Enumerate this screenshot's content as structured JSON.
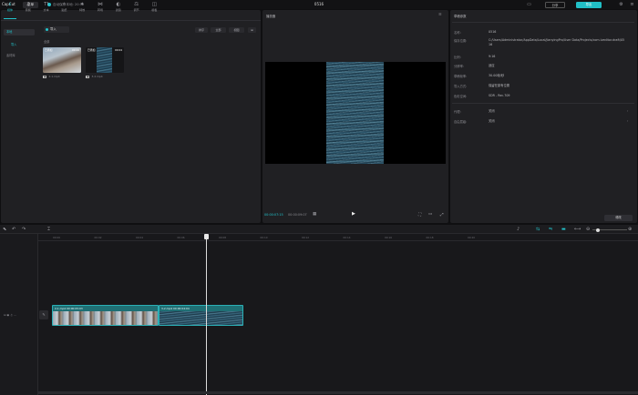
{
  "titlebar": {
    "logo": "CapCut",
    "menu_label": "菜单",
    "autosave": "自动保存本地: 20:52",
    "doc_title": "0516",
    "share_label": "分享",
    "export_label": "导出"
  },
  "tools": [
    {
      "icon": "⭳",
      "label": "媒体",
      "name": "media"
    },
    {
      "icon": "♫",
      "label": "音频",
      "name": "audio"
    },
    {
      "icon": "TI",
      "label": "文本",
      "name": "text"
    },
    {
      "icon": "✧",
      "label": "贴纸",
      "name": "sticker"
    },
    {
      "icon": "✦",
      "label": "特效",
      "name": "effects"
    },
    {
      "icon": "⋈",
      "label": "转场",
      "name": "transition"
    },
    {
      "icon": "◐",
      "label": "滤镜",
      "name": "filter"
    },
    {
      "icon": "⚖",
      "label": "调节",
      "name": "adjust"
    },
    {
      "icon": "◫",
      "label": "模板",
      "name": "template"
    }
  ],
  "sidebar": [
    "本地",
    "导入",
    "素材库"
  ],
  "media": {
    "import_label": "导入",
    "all_label": "全部",
    "sort_label": "排序",
    "filter_label": "全部",
    "view_label": "视图",
    "items": [
      {
        "tag": "已添加",
        "duration": "00:06",
        "caption": "2-1.mp4"
      },
      {
        "tag": "已添加",
        "duration": "00:04",
        "caption": "3-2.mp4"
      }
    ]
  },
  "player": {
    "title": "播放器",
    "time_current": "00:00:07:15",
    "time_total": "00:00:09:07",
    "play_icon": "▶"
  },
  "details": {
    "title": "草稿参数",
    "rows": [
      {
        "label": "名称:",
        "value": "0516"
      },
      {
        "label": "保存位置:",
        "value": "C:/Users/Administrator/AppData/Local/JianyingPro/User Data/Projects/com.lveditor.draft/0516"
      },
      {
        "label": "比例:",
        "value": "9:16"
      },
      {
        "label": "分辨率:",
        "value": "适应"
      },
      {
        "label": "草稿帧率:",
        "value": "30.00帧/秒"
      },
      {
        "label": "导入方式:",
        "value": "保留在原有位置"
      },
      {
        "label": "色彩空间:",
        "value": "SDR - Rec.709"
      }
    ],
    "extra_rows": [
      {
        "label": "代理:",
        "value": "关闭"
      },
      {
        "label": "自由层级:",
        "value": "关闭"
      }
    ],
    "modify_label": "修改"
  },
  "timeline": {
    "ticks": [
      "00:00",
      "00:02",
      "00:04",
      "00:06",
      "00:08",
      "00:10",
      "00:12",
      "00:14",
      "00:16",
      "00:18",
      "00:20"
    ],
    "clips": [
      {
        "label": "2-1.mp4 00:00:05:03"
      },
      {
        "label": "3-2.mp4 00:00:04:04"
      }
    ],
    "cover_label": "封面"
  }
}
